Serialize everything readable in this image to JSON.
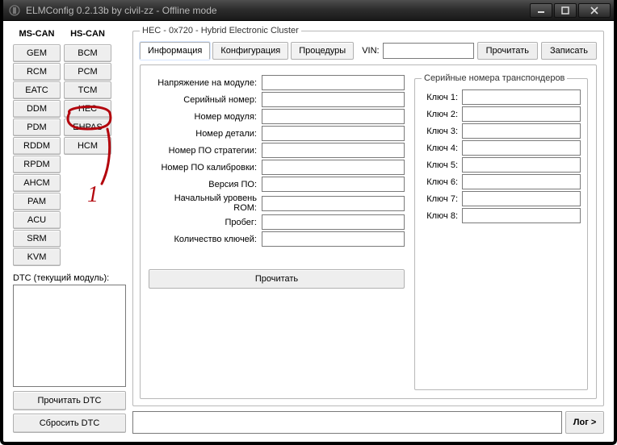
{
  "window": {
    "title": "ELMConfig 0.2.13b by civil-zz - Offline mode"
  },
  "left_cols": {
    "headers": [
      "MS-CAN",
      "HS-CAN"
    ],
    "ms": [
      "GEM",
      "RCM",
      "EATC",
      "DDM",
      "PDM",
      "RDDM",
      "RPDM",
      "AHCM",
      "PAM",
      "ACU",
      "SRM",
      "KVM"
    ],
    "hs": [
      "BCM",
      "PCM",
      "TCM",
      "HEC",
      "EHPAS",
      "HCM"
    ],
    "dtc_label": "DTC (текущий модуль):",
    "dtc_buttons": [
      "Прочитать DTC",
      "Сбросить DTC"
    ]
  },
  "module_panel": {
    "legend": "HEC - 0x720 - Hybrid Electronic Cluster",
    "tabs": [
      "Информация",
      "Конфигурация",
      "Процедуры"
    ],
    "active_tab": 0,
    "vin_label": "VIN:",
    "vin_value": "",
    "io_buttons": [
      "Прочитать",
      "Записать"
    ],
    "info_fields": [
      "Напряжение на модуле:",
      "Серийный номер:",
      "Номер модуля:",
      "Номер детали:",
      "Номер ПО стратегии:",
      "Номер ПО калибровки:",
      "Версия ПО:",
      "Начальный уровень ROM:",
      "Пробег:",
      "Количество ключей:"
    ],
    "info_values": [
      "",
      "",
      "",
      "",
      "",
      "",
      "",
      "",
      "",
      ""
    ],
    "read_button": "Прочитать",
    "transponders": {
      "legend": "Серийные номера транспондеров",
      "keys": [
        "Ключ 1:",
        "Ключ 2:",
        "Ключ 3:",
        "Ключ 4:",
        "Ключ 5:",
        "Ключ 6:",
        "Ключ 7:",
        "Ключ 8:"
      ],
      "values": [
        "",
        "",
        "",
        "",
        "",
        "",
        "",
        ""
      ]
    }
  },
  "log_button": "Лог >",
  "annotation": {
    "number": "1"
  }
}
